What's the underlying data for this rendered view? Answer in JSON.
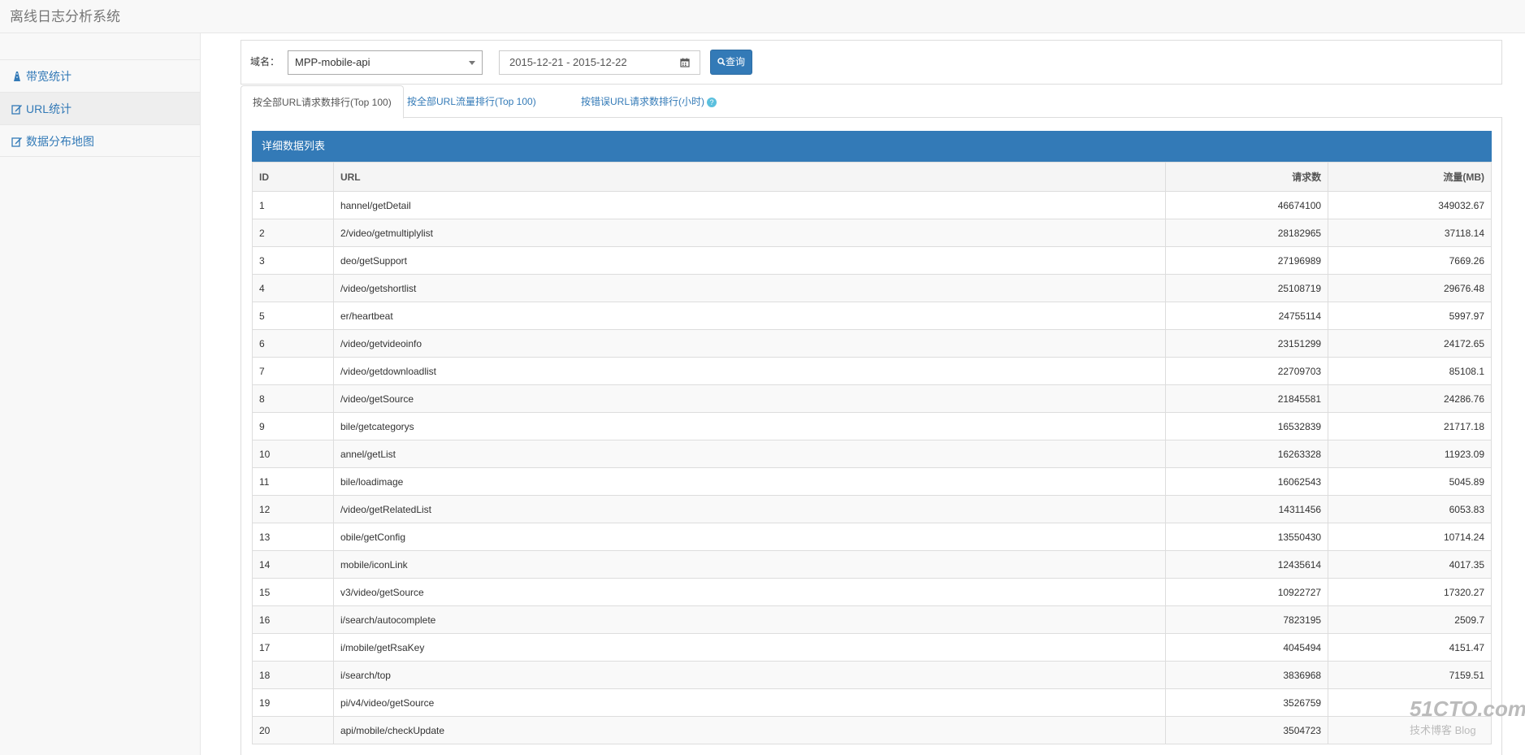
{
  "app": {
    "title": "离线日志分析系统"
  },
  "sidebar": {
    "items": [
      {
        "label": "带宽统计",
        "icon": "road-icon"
      },
      {
        "label": "URL统计",
        "icon": "edit-icon"
      },
      {
        "label": "数据分布地图",
        "icon": "edit-icon"
      }
    ]
  },
  "filter": {
    "domain_label": "域名：",
    "domain_value": "MPP-mobile-api",
    "date_range": "2015-12-21 - 2015-12-22",
    "query_label": "查询"
  },
  "tabs": [
    {
      "label": "按全部URL请求数排行(Top 100)"
    },
    {
      "label": "按全部URL流量排行(Top 100)"
    },
    {
      "label": "按错误URL请求数排行(小时)"
    }
  ],
  "panel": {
    "title": "详细数据列表"
  },
  "table": {
    "headers": {
      "id": "ID",
      "url": "URL",
      "requests": "请求数",
      "traffic": "流量(MB)"
    },
    "rows": [
      {
        "id": "1",
        "url": "hannel/getDetail",
        "requests": "46674100",
        "traffic": "349032.67"
      },
      {
        "id": "2",
        "url": "2/video/getmultiplylist",
        "requests": "28182965",
        "traffic": "37118.14"
      },
      {
        "id": "3",
        "url": "deo/getSupport",
        "requests": "27196989",
        "traffic": "7669.26"
      },
      {
        "id": "4",
        "url": "/video/getshortlist",
        "requests": "25108719",
        "traffic": "29676.48"
      },
      {
        "id": "5",
        "url": "er/heartbeat",
        "requests": "24755114",
        "traffic": "5997.97"
      },
      {
        "id": "6",
        "url": "/video/getvideoinfo",
        "requests": "23151299",
        "traffic": "24172.65"
      },
      {
        "id": "7",
        "url": "/video/getdownloadlist",
        "requests": "22709703",
        "traffic": "85108.1"
      },
      {
        "id": "8",
        "url": "/video/getSource",
        "requests": "21845581",
        "traffic": "24286.76"
      },
      {
        "id": "9",
        "url": "bile/getcategorys",
        "requests": "16532839",
        "traffic": "21717.18"
      },
      {
        "id": "10",
        "url": "annel/getList",
        "requests": "16263328",
        "traffic": "11923.09"
      },
      {
        "id": "11",
        "url": "bile/loadimage",
        "requests": "16062543",
        "traffic": "5045.89"
      },
      {
        "id": "12",
        "url": "/video/getRelatedList",
        "requests": "14311456",
        "traffic": "6053.83"
      },
      {
        "id": "13",
        "url": "obile/getConfig",
        "requests": "13550430",
        "traffic": "10714.24"
      },
      {
        "id": "14",
        "url": "mobile/iconLink",
        "requests": "12435614",
        "traffic": "4017.35"
      },
      {
        "id": "15",
        "url": "v3/video/getSource",
        "requests": "10922727",
        "traffic": "17320.27"
      },
      {
        "id": "16",
        "url": "i/search/autocomplete",
        "requests": "7823195",
        "traffic": "2509.7"
      },
      {
        "id": "17",
        "url": "i/mobile/getRsaKey",
        "requests": "4045494",
        "traffic": "4151.47"
      },
      {
        "id": "18",
        "url": "i/search/top",
        "requests": "3836968",
        "traffic": "7159.51"
      },
      {
        "id": "19",
        "url": "pi/v4/video/getSource",
        "requests": "3526759",
        "traffic": ""
      },
      {
        "id": "20",
        "url": "api/mobile/checkUpdate",
        "requests": "3504723",
        "traffic": ""
      }
    ]
  },
  "watermark": {
    "line1": "51CTO.com",
    "line2": "技术博客 Blog"
  },
  "colors": {
    "primary": "#337ab7",
    "link": "#337ab7",
    "sidebar_bg": "#f8f8f8",
    "border": "#dddddd"
  }
}
